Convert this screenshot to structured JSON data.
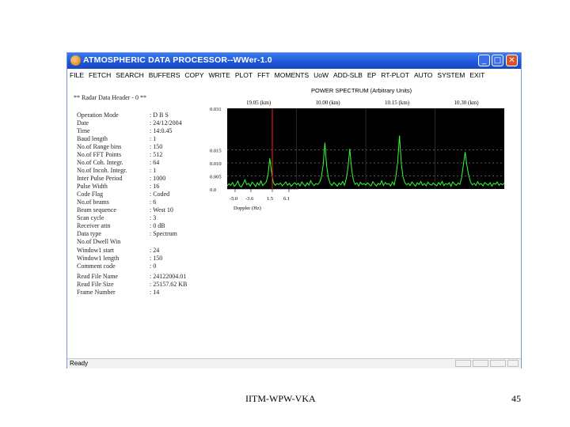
{
  "window": {
    "title": "ATMOSPHERIC DATA PROCESSOR--WWer-1.0",
    "minimize": "_",
    "maximize": "□",
    "close": "✕"
  },
  "menu": [
    "FILE",
    "FETCH",
    "SEARCH",
    "BUFFERS",
    "COPY",
    "WRITE",
    "PLOT",
    "FFT",
    "MOMENTS",
    "UoW",
    "ADD-SLB",
    "EP",
    "RT-PLOT",
    "AUTO",
    "SYSTEM",
    "EXIT"
  ],
  "info": {
    "header": "** Radar Data Header - 0 **",
    "rows": [
      {
        "label": "Operation Mode",
        "value": ": D B S"
      },
      {
        "label": "Date",
        "value": ": 24/12/2004"
      },
      {
        "label": "Time",
        "value": ": 14:0.45"
      },
      {
        "label": "Baud length",
        "value": ": 1"
      },
      {
        "label": "No.of Range bins",
        "value": ": 150"
      },
      {
        "label": "No.of FFT Points",
        "value": ": 512"
      },
      {
        "label": "No.of Coh. Integr.",
        "value": ": 64"
      },
      {
        "label": "No.of Incoh. Integr.",
        "value": ": 1"
      },
      {
        "label": "Inter Pulse Period",
        "value": ": 1000"
      },
      {
        "label": "Pulse Width",
        "value": ": 16"
      },
      {
        "label": "Code Flag",
        "value": ": Coded"
      },
      {
        "label": "No.of beams",
        "value": ": 6"
      },
      {
        "label": "Beam sequence",
        "value": ": West 10"
      },
      {
        "label": "Scan cycle",
        "value": ": 3"
      },
      {
        "label": "Receiver attn",
        "value": ": 0 dB"
      },
      {
        "label": "Data type",
        "value": ": Spectrum"
      },
      {
        "label": "No.of Dwell Win",
        "value": ""
      },
      {
        "label": "Window1 start",
        "value": ": 24"
      },
      {
        "label": "Window1 length",
        "value": ": 150"
      },
      {
        "label": "Comment code",
        "value": ": 0"
      },
      {
        "label": "Read File Name",
        "value": ": 24122004.01"
      },
      {
        "label": "Read File Size",
        "value": ": 25157.62 KB"
      },
      {
        "label": "Frame Number",
        "value": ": 14"
      }
    ]
  },
  "chart_data": {
    "type": "line",
    "title": "POWER SPECTRUM (Arbitrary Units)",
    "panel_labels": [
      "19.05 (km)",
      "10.00 (km)",
      "10.15 (km)",
      "10.30 (km)"
    ],
    "xlabel": "Doppler (Hz)",
    "x_ticks": [
      "-5.0",
      "-3.6",
      "1.5",
      "6.1"
    ],
    "ylabel": "",
    "y_ticks": [
      "0.031",
      "0.015",
      "0.010",
      "0.005",
      "0.0"
    ],
    "ylim": [
      0,
      0.031
    ],
    "grid": true,
    "colors": {
      "background": "#000000",
      "trace": "#33ff33",
      "marker": "#ff2020",
      "grid": "#888888"
    },
    "series": [
      {
        "values": [
          0.0012,
          0.002,
          0.0014,
          0.0025,
          0.001,
          0.0018,
          0.003,
          0.0012,
          0.0008,
          0.002,
          0.0035,
          0.0016,
          0.0022,
          0.0011,
          0.0026,
          0.0019,
          0.0009,
          0.0024,
          0.0015,
          0.0031,
          0.0013,
          0.002,
          0.0028,
          0.0056,
          0.0118,
          0.0062,
          0.0025,
          0.0014,
          0.0021,
          0.0017,
          0.0023,
          0.0012,
          0.0019,
          0.0027,
          0.0015,
          0.0022,
          0.0011,
          0.0018,
          0.0024,
          0.0016
        ]
      },
      {
        "values": [
          0.0016,
          0.0022,
          0.0012,
          0.0027,
          0.0018,
          0.0011,
          0.0024,
          0.0015,
          0.0032,
          0.0019,
          0.0013,
          0.0021,
          0.0017,
          0.0026,
          0.0045,
          0.0092,
          0.0178,
          0.0088,
          0.0042,
          0.0021,
          0.0014,
          0.0025,
          0.0018,
          0.0011,
          0.0023,
          0.0016,
          0.0029,
          0.0014,
          0.0038,
          0.0082,
          0.0155,
          0.0078,
          0.0035,
          0.0018,
          0.0023,
          0.0012,
          0.0026,
          0.0017,
          0.0021,
          0.0015
        ]
      },
      {
        "values": [
          0.0014,
          0.0024,
          0.0017,
          0.0012,
          0.0028,
          0.0019,
          0.0011,
          0.0022,
          0.0016,
          0.0031,
          0.0013,
          0.0025,
          0.0018,
          0.0021,
          0.0012,
          0.0027,
          0.0015,
          0.0048,
          0.0105,
          0.0205,
          0.0098,
          0.0046,
          0.0024,
          0.0016,
          0.0022,
          0.0013,
          0.0027,
          0.0018,
          0.0011,
          0.0024,
          0.0017,
          0.0029,
          0.0014,
          0.0021,
          0.0012,
          0.0026,
          0.0018,
          0.0015,
          0.0023,
          0.0016
        ]
      },
      {
        "values": [
          0.0018,
          0.0012,
          0.0025,
          0.0016,
          0.0029,
          0.0013,
          0.0021,
          0.0017,
          0.0024,
          0.0011,
          0.0027,
          0.0019,
          0.0014,
          0.0023,
          0.0018,
          0.0045,
          0.0095,
          0.0142,
          0.0088,
          0.0052,
          0.0026,
          0.0016,
          0.0022,
          0.0013,
          0.0028,
          0.0017,
          0.0021,
          0.0012,
          0.0025,
          0.0019,
          0.0015,
          0.0024,
          0.0011,
          0.0022,
          0.0018,
          0.0027,
          0.0014,
          0.0021,
          0.0016,
          0.0023
        ]
      }
    ]
  },
  "status": {
    "text": "Ready"
  },
  "slide": {
    "footer": "IITM-WPW-VKA",
    "page": "45"
  }
}
